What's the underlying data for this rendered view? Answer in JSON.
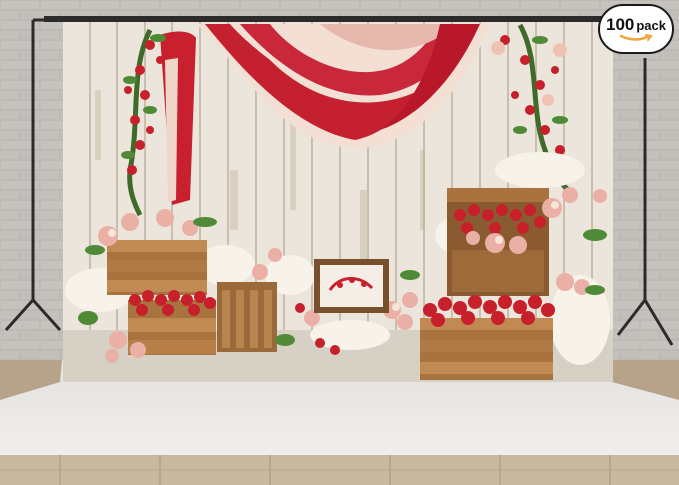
{
  "badge": {
    "number": "100",
    "unit": "pack"
  },
  "colors": {
    "brick_wall": "#b9b6b1",
    "backdrop_wood": "#ece6dc",
    "drape_red": "#c21f2f",
    "drape_cream": "#f2dccf",
    "strawberry": "#c8202a",
    "rose_pink": "#eab0a6",
    "crate_wood": "#a8733f",
    "floor_wood": "#c8b79f",
    "badge_smile": "#f3a33a"
  },
  "icons": [
    "smile-arrow-icon"
  ]
}
